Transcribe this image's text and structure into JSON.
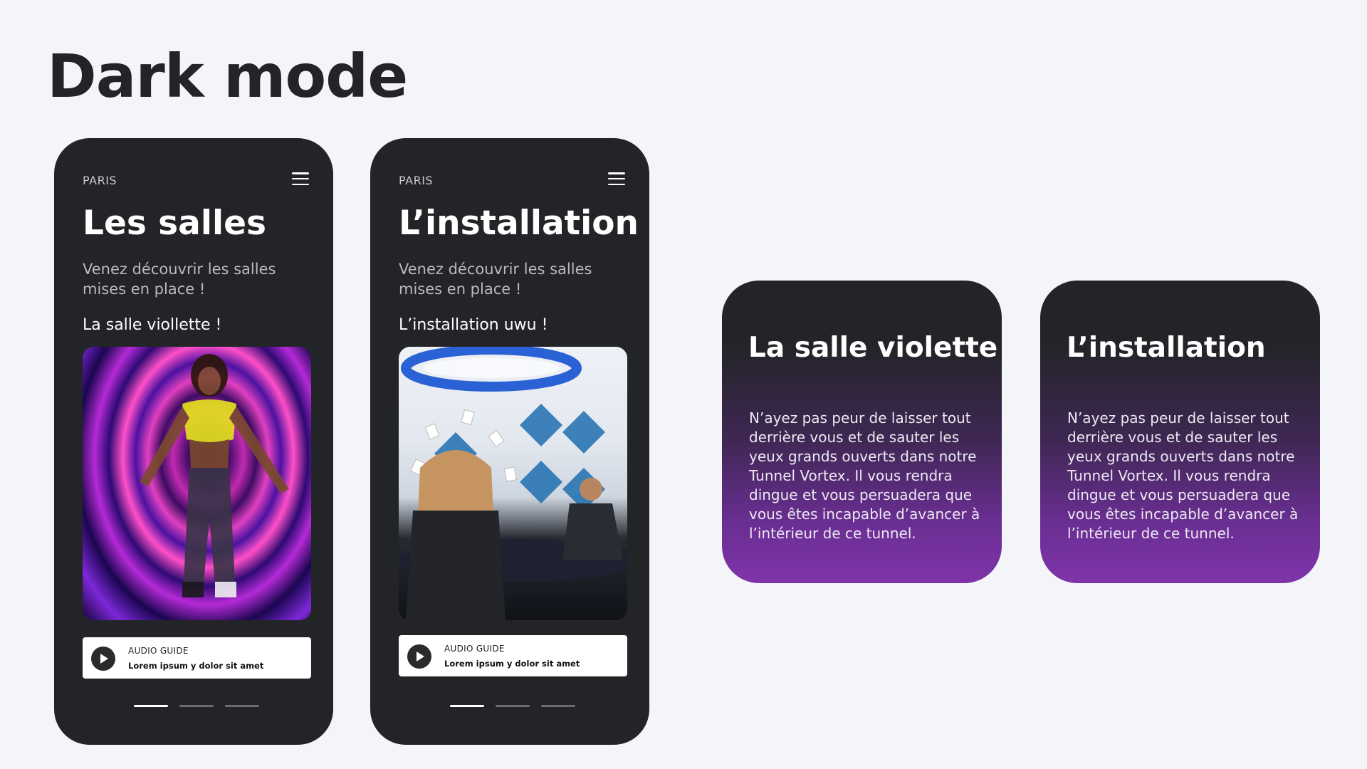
{
  "page": {
    "title": "Dark mode"
  },
  "phones": [
    {
      "city": "PARIS",
      "heading": "Les salles",
      "subtitle": "Venez découvrir les salles mises en place !",
      "section_title": "La salle viollette !",
      "photo_alt": "purple-tunnel-photo",
      "audio": {
        "title": "AUDIO GUIDE",
        "text": "Lorem ipsum y dolor sit amet"
      },
      "pagination": {
        "total": 3,
        "active": 1
      }
    },
    {
      "city": "PARIS",
      "heading": "L’installation",
      "subtitle": "Venez découvrir les salles mises en place !",
      "section_title": "L’installation uwu !",
      "photo_alt": "installation-photo",
      "audio": {
        "title": "AUDIO GUIDE",
        "text": "Lorem ipsum y dolor sit amet"
      },
      "pagination": {
        "total": 3,
        "active": 1
      }
    }
  ],
  "cards": [
    {
      "title": "La salle violette",
      "body": "N’ayez pas peur de laisser tout derrière vous et de sauter les yeux grands ouverts dans notre Tunnel Vortex. Il vous rendra dingue et vous persuadera que vous êtes incapable d’avancer à l’intérieur de ce tunnel."
    },
    {
      "title": "L’installation",
      "body": "N’ayez pas peur de laisser tout derrière vous et de sauter les yeux grands ouverts dans notre Tunnel Vortex. Il vous rendra dingue et vous persuadera que vous êtes incapable d’avancer à l’intérieur de ce tunnel."
    }
  ],
  "colors": {
    "background": "#f3f5f9",
    "phone_bg": "#232427",
    "card_gradient_end": "#7f34a9",
    "text_dark": "#232427"
  },
  "icons": {
    "menu": "hamburger-menu-icon",
    "play": "play-icon"
  }
}
